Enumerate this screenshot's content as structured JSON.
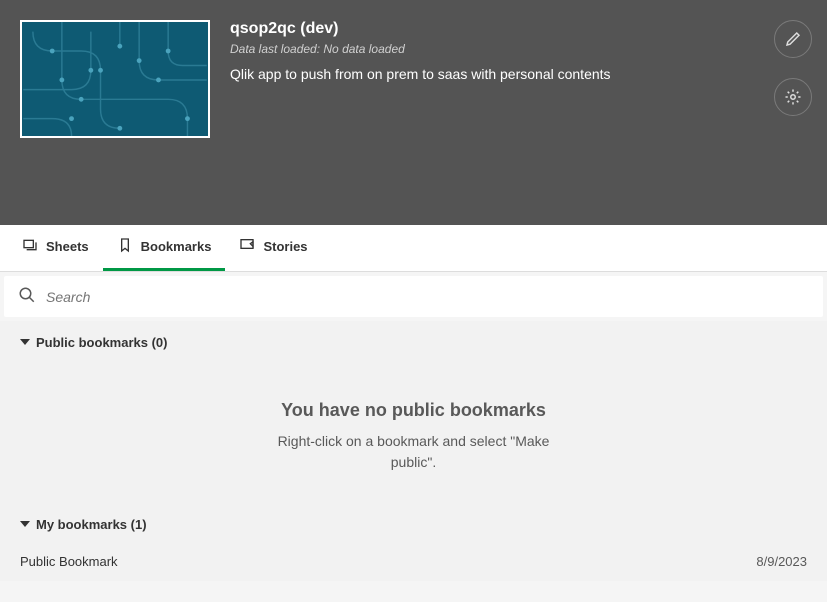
{
  "header": {
    "title": "qsop2qc (dev)",
    "subtitle": "Data last loaded: No data loaded",
    "description": "Qlik app to push from on prem to saas with personal contents"
  },
  "tabs": {
    "sheets": "Sheets",
    "bookmarks": "Bookmarks",
    "stories": "Stories"
  },
  "search": {
    "placeholder": "Search"
  },
  "sections": {
    "public": {
      "label": "Public bookmarks (0)",
      "empty_title": "You have no public bookmarks",
      "empty_sub": "Right-click on a bookmark and select \"Make public\"."
    },
    "my": {
      "label": "My bookmarks (1)",
      "items": [
        {
          "name": "Public Bookmark",
          "date": "8/9/2023"
        }
      ]
    }
  }
}
